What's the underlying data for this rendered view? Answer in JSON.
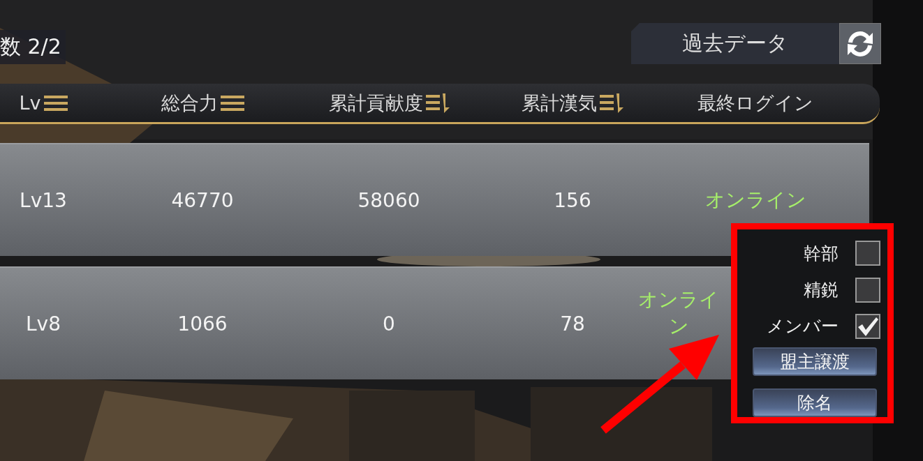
{
  "member_count": "数 2/2",
  "history_button": "過去データ",
  "columns": [
    {
      "label": "Lv",
      "kind": "lines"
    },
    {
      "label": "総合力",
      "kind": "lines"
    },
    {
      "label": "累計貢献度",
      "kind": "desc"
    },
    {
      "label": "累計漢気",
      "kind": "desc"
    },
    {
      "label": "最終ログイン",
      "kind": "none"
    }
  ],
  "rows": [
    {
      "cells": [
        "Lv13",
        "46770",
        "58060",
        "156"
      ],
      "status": "オンライン",
      "color": "#a6ef6a"
    },
    {
      "cells": [
        "Lv8",
        "1066",
        "0",
        "78"
      ],
      "status": "オンライン",
      "color": "#a6ef6a"
    }
  ],
  "menu": {
    "options": [
      {
        "label": "幹部",
        "checked": false
      },
      {
        "label": "精鋭",
        "checked": false
      },
      {
        "label": "メンバー",
        "checked": true
      }
    ],
    "buttons": [
      "盟主譲渡",
      "除名"
    ]
  }
}
